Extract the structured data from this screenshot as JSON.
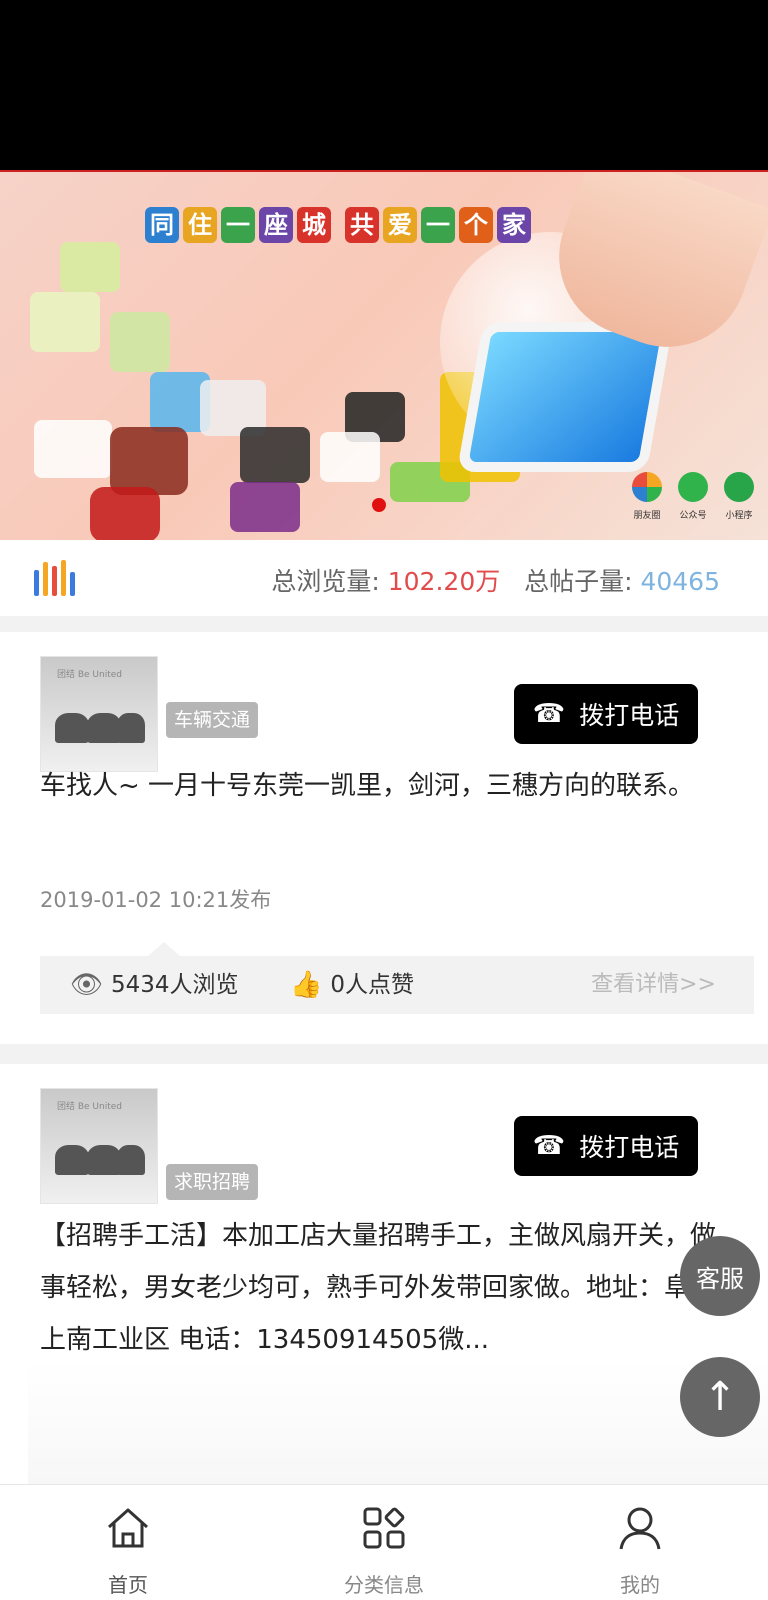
{
  "banner": {
    "slogan_chars": [
      "同",
      "住",
      "一",
      "座",
      "城",
      "共",
      "爱",
      "一",
      "个",
      "家"
    ],
    "slogan_colors": [
      "#2d7fd0",
      "#e7a521",
      "#3aa34b",
      "#6b46a8",
      "#d8332b",
      "#d8332b",
      "#e7a521",
      "#3aa34b",
      "#e0601a",
      "#6b46a8"
    ],
    "share": [
      {
        "label": "朋友圈",
        "color": "#f5a623"
      },
      {
        "label": "公众号",
        "color": "#2fb34a"
      },
      {
        "label": "小程序",
        "color": "#27a548"
      }
    ]
  },
  "stats": {
    "views_label": "总浏览量:",
    "views_value": "102.20万",
    "posts_label": "总帖子量:",
    "posts_value": "40465"
  },
  "posts": [
    {
      "thumb_text": "团结 Be United",
      "category": "车辆交通",
      "call_label": "拨打电话",
      "content": "车找人~ 一月十号东莞一凯里，剑河，三穗方向的联系。",
      "date": "2019-01-02 10:21发布",
      "views": "5434人浏览",
      "likes": "0人点赞",
      "detail_link": "查看详情>>"
    },
    {
      "thumb_text": "团结 Be United",
      "category": "求职招聘",
      "call_label": "拨打电话",
      "content": "【招聘手工活】本加工店大量招聘手工，主做风扇开关，做事轻松，男女老少均可，熟手可外发带回家做。地址：阜沙上南工业区 电话：13450914505微..."
    }
  ],
  "floating": {
    "service_label": "客服",
    "top_label": "↑"
  },
  "tabbar": [
    {
      "label": "首页",
      "icon": "home-icon"
    },
    {
      "label": "分类信息",
      "icon": "category-grid-icon"
    },
    {
      "label": "我的",
      "icon": "user-icon"
    }
  ]
}
